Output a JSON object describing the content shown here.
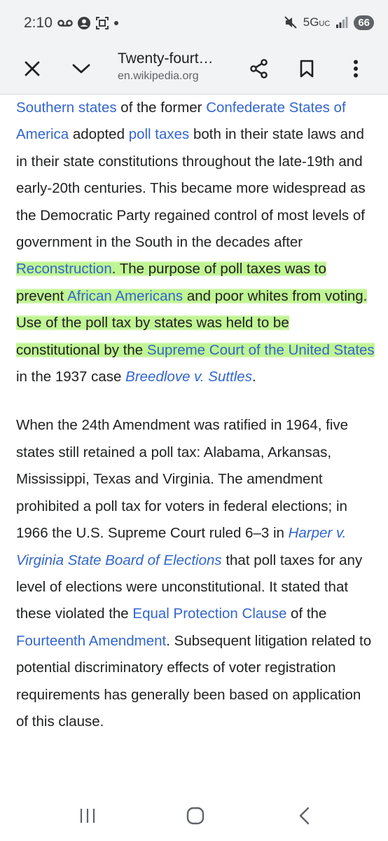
{
  "status_bar": {
    "time": "2:10",
    "network": "5G",
    "network_sub": "UC",
    "battery": "66"
  },
  "toolbar": {
    "title": "Twenty-fourt…",
    "url": "en.wikipedia.org",
    "close_icon": "close-icon",
    "collapse_icon": "chevron-down-icon",
    "share_icon": "share-icon",
    "bookmark_icon": "bookmark-icon",
    "menu_icon": "more-vert-icon"
  },
  "article": {
    "p1": {
      "s1_link1": "Southern states",
      "s1_text1": " of the former ",
      "s1_link2": "Confederate States of America",
      "s1_text2": " adopted ",
      "s1_link3": "poll taxes",
      "s1_text3": " both in their state laws and in their state constitutions throughout the late-19th and early-20th centuries. This became more widespread as the Democratic Party regained control of most levels of government in the South in the decades after ",
      "s1_link4": "Reconstruction",
      "s1_text4": ". The purpose of poll taxes was to prevent ",
      "s1_link5": "African Americans",
      "s1_text5": " and poor whites from voting. Use of the poll tax by states was held to be constitutional by the ",
      "s1_link6": "Supreme Court of the United States",
      "s1_text6": " in the 1937 case ",
      "s1_link7": "Breedlove v. Suttles",
      "s1_text7": "."
    },
    "p2": {
      "t1": "When the 24th Amendment was ratified in 1964, five states still retained a poll tax: Alabama, Arkansas, Mississippi, Texas and Virginia. The amendment prohibited a poll tax for voters in federal elections; in 1966 the U.S. Supreme Court ruled 6–3 in ",
      "l1": "Harper v. Virginia State Board of Elections",
      "t2": " that poll taxes for any level of elections were unconstitutional. It stated that these violated the ",
      "l2": "Equal Protection Clause",
      "t3": " of the ",
      "l3": "Fourteenth Amendment",
      "t4": ". Subsequent litigation related to potential discriminatory effects of voter registration requirements has generally been based on application of this clause."
    }
  },
  "navbar": {
    "recents_icon": "recents-icon",
    "home_icon": "home-icon",
    "back_icon": "back-icon"
  },
  "colors": {
    "link": "#3366cc",
    "highlight": "#8cec3c",
    "chrome_bg": "#f1f3f4"
  }
}
